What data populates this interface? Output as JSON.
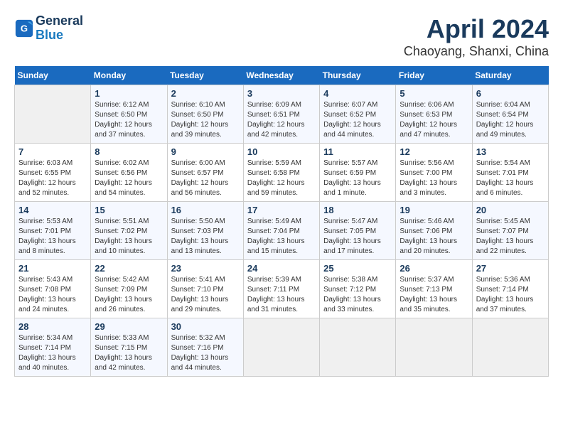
{
  "header": {
    "logo_line1": "General",
    "logo_line2": "Blue",
    "title": "April 2024",
    "subtitle": "Chaoyang, Shanxi, China"
  },
  "weekdays": [
    "Sunday",
    "Monday",
    "Tuesday",
    "Wednesday",
    "Thursday",
    "Friday",
    "Saturday"
  ],
  "weeks": [
    [
      {
        "day": "",
        "empty": true
      },
      {
        "day": "1",
        "sunrise": "6:12 AM",
        "sunset": "6:50 PM",
        "daylight": "12 hours and 37 minutes."
      },
      {
        "day": "2",
        "sunrise": "6:10 AM",
        "sunset": "6:50 PM",
        "daylight": "12 hours and 39 minutes."
      },
      {
        "day": "3",
        "sunrise": "6:09 AM",
        "sunset": "6:51 PM",
        "daylight": "12 hours and 42 minutes."
      },
      {
        "day": "4",
        "sunrise": "6:07 AM",
        "sunset": "6:52 PM",
        "daylight": "12 hours and 44 minutes."
      },
      {
        "day": "5",
        "sunrise": "6:06 AM",
        "sunset": "6:53 PM",
        "daylight": "12 hours and 47 minutes."
      },
      {
        "day": "6",
        "sunrise": "6:04 AM",
        "sunset": "6:54 PM",
        "daylight": "12 hours and 49 minutes."
      }
    ],
    [
      {
        "day": "7",
        "sunrise": "6:03 AM",
        "sunset": "6:55 PM",
        "daylight": "12 hours and 52 minutes."
      },
      {
        "day": "8",
        "sunrise": "6:02 AM",
        "sunset": "6:56 PM",
        "daylight": "12 hours and 54 minutes."
      },
      {
        "day": "9",
        "sunrise": "6:00 AM",
        "sunset": "6:57 PM",
        "daylight": "12 hours and 56 minutes."
      },
      {
        "day": "10",
        "sunrise": "5:59 AM",
        "sunset": "6:58 PM",
        "daylight": "12 hours and 59 minutes."
      },
      {
        "day": "11",
        "sunrise": "5:57 AM",
        "sunset": "6:59 PM",
        "daylight": "13 hours and 1 minute."
      },
      {
        "day": "12",
        "sunrise": "5:56 AM",
        "sunset": "7:00 PM",
        "daylight": "13 hours and 3 minutes."
      },
      {
        "day": "13",
        "sunrise": "5:54 AM",
        "sunset": "7:01 PM",
        "daylight": "13 hours and 6 minutes."
      }
    ],
    [
      {
        "day": "14",
        "sunrise": "5:53 AM",
        "sunset": "7:01 PM",
        "daylight": "13 hours and 8 minutes."
      },
      {
        "day": "15",
        "sunrise": "5:51 AM",
        "sunset": "7:02 PM",
        "daylight": "13 hours and 10 minutes."
      },
      {
        "day": "16",
        "sunrise": "5:50 AM",
        "sunset": "7:03 PM",
        "daylight": "13 hours and 13 minutes."
      },
      {
        "day": "17",
        "sunrise": "5:49 AM",
        "sunset": "7:04 PM",
        "daylight": "13 hours and 15 minutes."
      },
      {
        "day": "18",
        "sunrise": "5:47 AM",
        "sunset": "7:05 PM",
        "daylight": "13 hours and 17 minutes."
      },
      {
        "day": "19",
        "sunrise": "5:46 AM",
        "sunset": "7:06 PM",
        "daylight": "13 hours and 20 minutes."
      },
      {
        "day": "20",
        "sunrise": "5:45 AM",
        "sunset": "7:07 PM",
        "daylight": "13 hours and 22 minutes."
      }
    ],
    [
      {
        "day": "21",
        "sunrise": "5:43 AM",
        "sunset": "7:08 PM",
        "daylight": "13 hours and 24 minutes."
      },
      {
        "day": "22",
        "sunrise": "5:42 AM",
        "sunset": "7:09 PM",
        "daylight": "13 hours and 26 minutes."
      },
      {
        "day": "23",
        "sunrise": "5:41 AM",
        "sunset": "7:10 PM",
        "daylight": "13 hours and 29 minutes."
      },
      {
        "day": "24",
        "sunrise": "5:39 AM",
        "sunset": "7:11 PM",
        "daylight": "13 hours and 31 minutes."
      },
      {
        "day": "25",
        "sunrise": "5:38 AM",
        "sunset": "7:12 PM",
        "daylight": "13 hours and 33 minutes."
      },
      {
        "day": "26",
        "sunrise": "5:37 AM",
        "sunset": "7:13 PM",
        "daylight": "13 hours and 35 minutes."
      },
      {
        "day": "27",
        "sunrise": "5:36 AM",
        "sunset": "7:14 PM",
        "daylight": "13 hours and 37 minutes."
      }
    ],
    [
      {
        "day": "28",
        "sunrise": "5:34 AM",
        "sunset": "7:14 PM",
        "daylight": "13 hours and 40 minutes."
      },
      {
        "day": "29",
        "sunrise": "5:33 AM",
        "sunset": "7:15 PM",
        "daylight": "13 hours and 42 minutes."
      },
      {
        "day": "30",
        "sunrise": "5:32 AM",
        "sunset": "7:16 PM",
        "daylight": "13 hours and 44 minutes."
      },
      {
        "day": "",
        "empty": true
      },
      {
        "day": "",
        "empty": true
      },
      {
        "day": "",
        "empty": true
      },
      {
        "day": "",
        "empty": true
      }
    ]
  ]
}
